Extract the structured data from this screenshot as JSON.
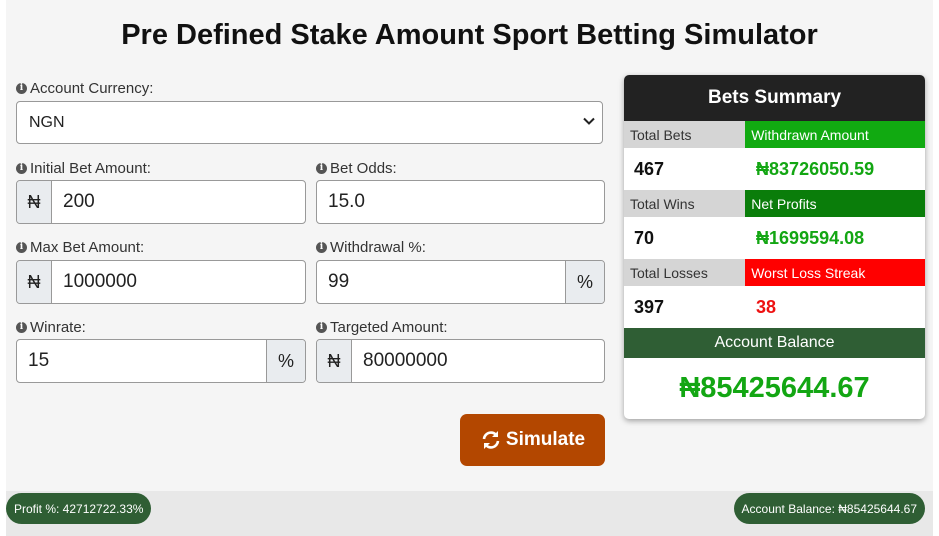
{
  "title": "Pre Defined Stake Amount Sport Betting Simulator",
  "form": {
    "currency_label": "Account Currency:",
    "currency_value": "NGN",
    "initial_bet_label": "Initial Bet Amount:",
    "initial_bet_value": "200",
    "bet_odds_label": "Bet Odds:",
    "bet_odds_value": "15.0",
    "max_bet_label": "Max Bet Amount:",
    "max_bet_value": "1000000",
    "withdrawal_label": "Withdrawal %:",
    "withdrawal_value": "99",
    "winrate_label": "Winrate:",
    "winrate_value": "15",
    "target_label": "Targeted Amount:",
    "target_value": "80000000",
    "currency_symbol": "₦",
    "percent_symbol": "%",
    "simulate_label": "Simulate"
  },
  "summary": {
    "heading": "Bets Summary",
    "total_bets_label": "Total Bets",
    "total_bets_value": "467",
    "withdrawn_label": "Withdrawn Amount",
    "withdrawn_value": "₦83726050.59",
    "total_wins_label": "Total Wins",
    "total_wins_value": "70",
    "net_profits_label": "Net Profits",
    "net_profits_value": "₦1699594.08",
    "total_losses_label": "Total Losses",
    "total_losses_value": "397",
    "worst_streak_label": "Worst Loss Streak",
    "worst_streak_value": "38",
    "balance_label": "Account Balance",
    "balance_value": "₦85425644.67"
  },
  "footer": {
    "profit_text": "Profit %: 42712722.33%",
    "balance_text": "Account Balance: ₦85425644.67"
  },
  "colors": {
    "simulate_button": "#b34700",
    "dark_green": "#2f5e34",
    "green_text": "#13a613",
    "red": "#ff0000"
  },
  "icons": [
    "info-icon",
    "chevron-down-icon",
    "refresh-icon"
  ]
}
